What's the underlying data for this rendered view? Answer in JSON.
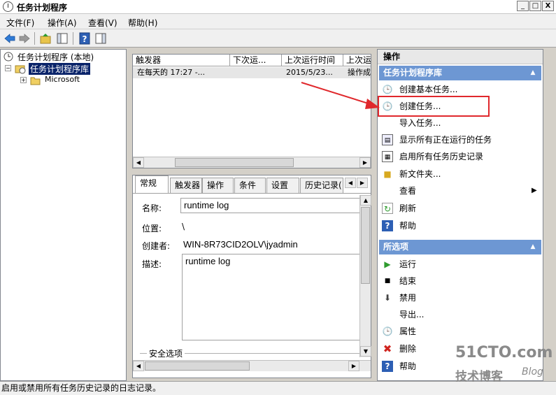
{
  "window": {
    "title": "任务计划程序",
    "min": "_",
    "max": "□",
    "close": "X"
  },
  "menu": [
    "文件(F)",
    "操作(A)",
    "查看(V)",
    "帮助(H)"
  ],
  "tree": {
    "root": "任务计划程序 (本地)",
    "library": "任务计划程序库",
    "child": "Microsoft"
  },
  "task_list": {
    "columns": [
      "触发器",
      "下次运...",
      "上次运行时间",
      "上次运"
    ],
    "row": [
      "在每天的 17:27 -...",
      "",
      "2015/5/23...",
      "操作成"
    ]
  },
  "tabs": [
    "常规",
    "触发器",
    "操作",
    "条件",
    "设置",
    "历史记录("
  ],
  "general": {
    "name_label": "名称:",
    "name_value": "runtime log",
    "location_label": "位置:",
    "location_value": "\\",
    "author_label": "创建者:",
    "author_value": "WIN-8R73CID2OLV\\jyadmin",
    "desc_label": "描述:",
    "desc_value": "runtime log",
    "security_label": "安全选项"
  },
  "actions": {
    "header": "操作",
    "section1": "任务计划程序库",
    "items1": [
      "创建基本任务...",
      "创建任务...",
      "导入任务...",
      "显示所有正在运行的任务",
      "启用所有任务历史记录",
      "新文件夹...",
      "查看",
      "刷新",
      "帮助"
    ],
    "section2": "所选项",
    "items2": [
      "运行",
      "结束",
      "禁用",
      "导出...",
      "属性",
      "删除",
      "帮助"
    ]
  },
  "status": "启用或禁用所有任务历史记录的日志记录。",
  "watermark": {
    "line1": "51CTO.com",
    "line2": "技术博客",
    "line3": "Blog"
  },
  "colors": {
    "section_blue": "#6d97d3",
    "highlight_red": "#e0282c",
    "selected_blue": "#0a246a"
  }
}
